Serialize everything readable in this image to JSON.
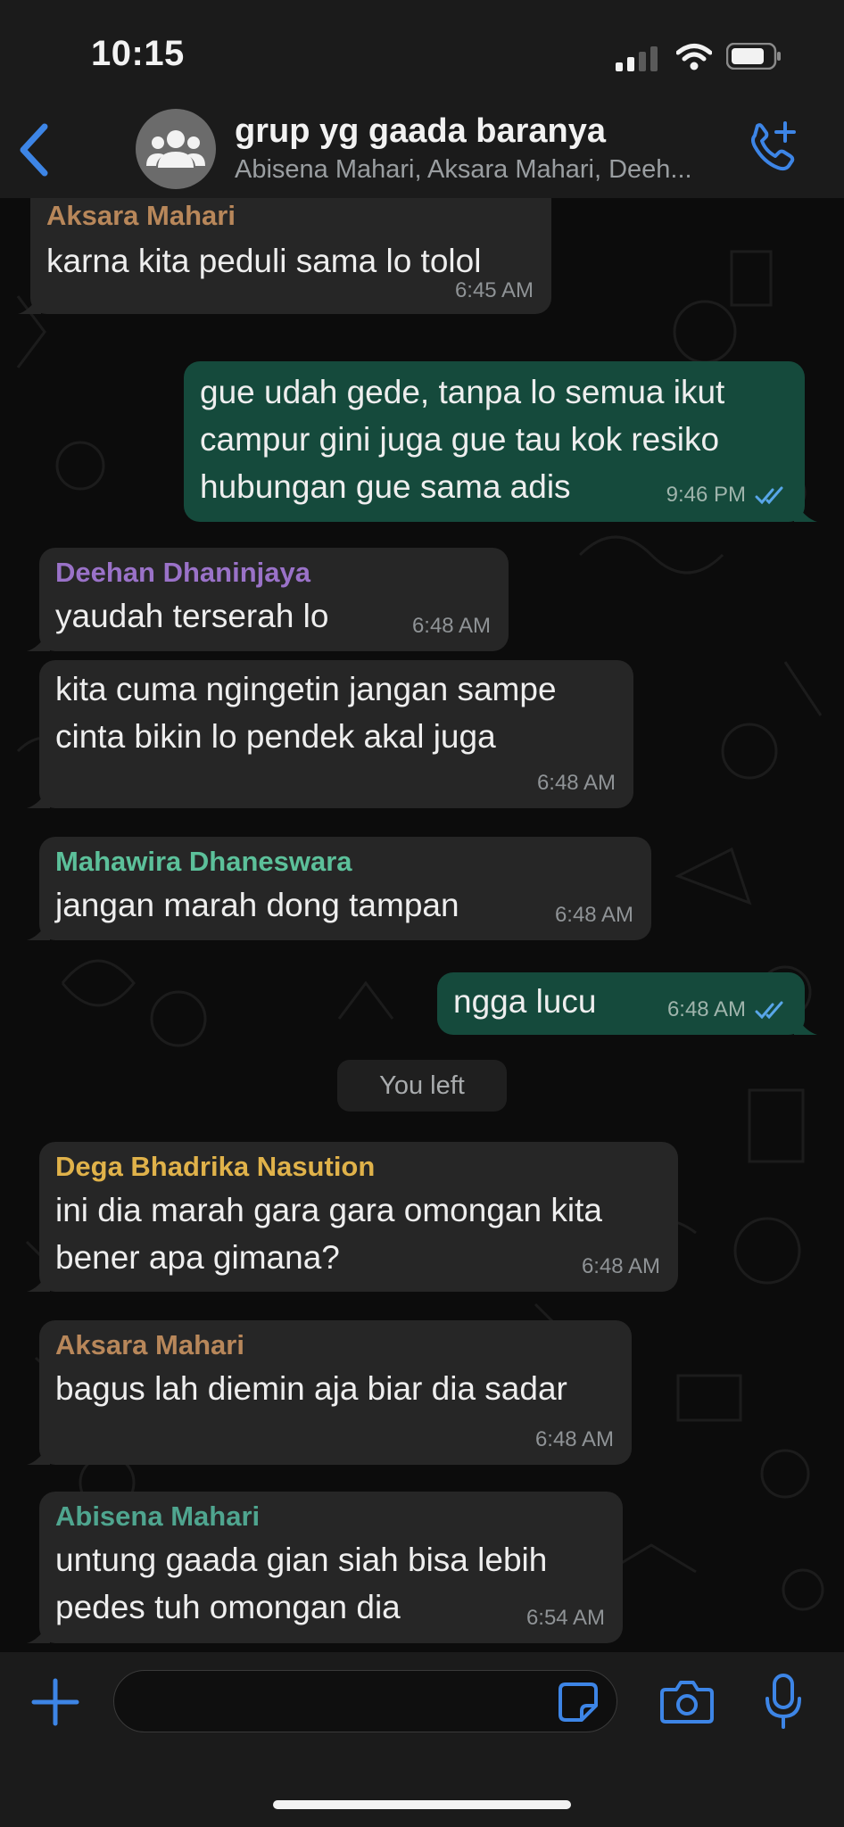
{
  "status_bar": {
    "time": "10:15"
  },
  "header": {
    "group_name": "grup yg gaada baranya",
    "members": "Abisena Mahari, Aksara Mahari, Deeh..."
  },
  "colors": {
    "accent": "#3d85e6",
    "incoming_bubble": "#262626",
    "outgoing_bubble": "#154a3c",
    "sender_aksara": "#b8875a",
    "sender_deehan": "#9a72c8",
    "sender_mahawira": "#5cc09a",
    "sender_dega": "#e0b24a",
    "sender_abisena": "#4fa58f"
  },
  "messages": [
    {
      "sender": "Aksara Mahari",
      "text": "karna kita peduli sama lo tolol",
      "time": "6:45 AM"
    },
    {
      "text": "gue udah gede, tanpa lo semua ikut\ncampur gini juga gue tau kok resiko\nhubungan gue sama adis",
      "time": "9:46 PM"
    },
    {
      "sender": "Deehan Dhaninjaya",
      "text": "yaudah terserah lo",
      "time": "6:48 AM"
    },
    {
      "text": "kita cuma ngingetin jangan sampe\ncinta bikin lo pendek akal juga",
      "time": "6:48 AM"
    },
    {
      "sender": "Mahawira Dhaneswara",
      "text": "jangan marah dong tampan",
      "time": "6:48 AM"
    },
    {
      "text": "ngga lucu",
      "time": "6:48 AM"
    },
    {
      "sender": "Dega Bhadrika Nasution",
      "text": "ini dia marah gara gara omongan kita\nbener apa gimana?",
      "time": "6:48 AM"
    },
    {
      "sender": "Aksara Mahari",
      "text": "bagus lah diemin aja biar dia sadar",
      "time": "6:48 AM"
    },
    {
      "sender": "Abisena Mahari",
      "text": "untung gaada gian siah bisa lebih\npedes tuh omongan dia",
      "time": "6:54 AM"
    }
  ],
  "system_message": "You left",
  "composer": {
    "input_value": ""
  }
}
